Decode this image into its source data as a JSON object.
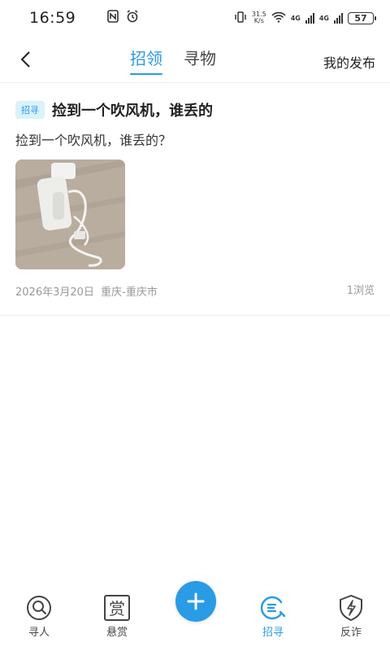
{
  "status_bar": {
    "time": "16:59",
    "net_speed_value": "31.5",
    "net_speed_unit": "K/s",
    "net_type_1": "4G",
    "net_type_2": "4G",
    "battery": "57"
  },
  "header": {
    "tabs": [
      {
        "label": "招领",
        "active": true
      },
      {
        "label": "寻物",
        "active": false
      }
    ],
    "my_posts": "我的发布"
  },
  "posts": [
    {
      "tag": "招寻",
      "title": "捡到一个吹风机，谁丢的",
      "description": "捡到一个吹风机，谁丢的？",
      "date": "2026年3月20日",
      "location": "重庆-重庆市",
      "views": "1浏览"
    }
  ],
  "bottom_nav": {
    "items": [
      {
        "label": "寻人",
        "icon": "search-person-icon",
        "active": false
      },
      {
        "label": "悬赏",
        "icon": "reward-icon",
        "active": false
      },
      {
        "label": "招寻",
        "icon": "find-icon",
        "active": true
      },
      {
        "label": "反诈",
        "icon": "shield-icon",
        "active": false
      }
    ]
  },
  "colors": {
    "accent": "#2a9be5",
    "tag_bg": "#d9f2fb",
    "meta_text": "#999999"
  }
}
